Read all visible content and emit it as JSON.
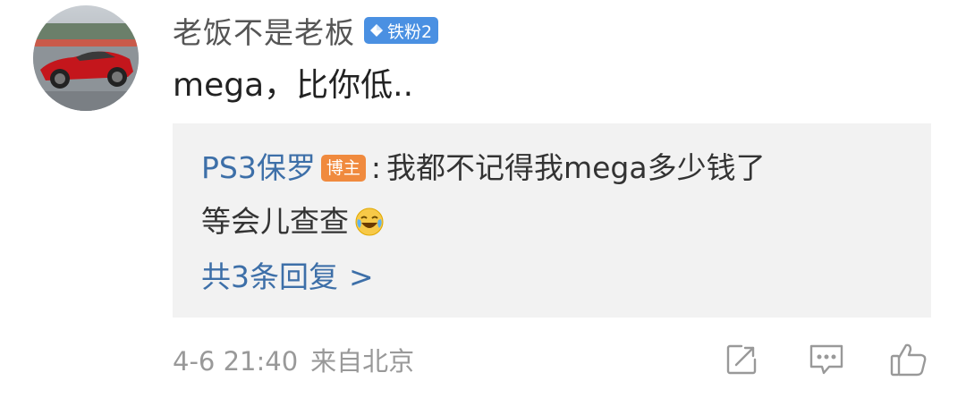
{
  "comment": {
    "username": "老饭不是老板",
    "fan_badge": "铁粉2",
    "text": "mega，比你低..",
    "time": "4-6 21:40",
    "location": "来自北京"
  },
  "reply": {
    "username": "PS3保罗",
    "badge": "博主",
    "colon": ":",
    "line1": "我都不记得我mega多少钱了",
    "line2": "等会儿查查",
    "emoji": "laughing-tears-emoji",
    "more_label": "共3条回复",
    "more_arrow": ">"
  },
  "actions": {
    "repost_icon": "repost-icon",
    "comment_icon": "comment-icon",
    "like_icon": "thumbs-up-icon"
  },
  "colors": {
    "link_blue": "#3d6fa8",
    "fan_badge_blue": "#4a90e2",
    "blogger_badge_orange": "#f08a3e",
    "reply_bg": "#f2f2f2",
    "meta_gray": "#999999"
  }
}
